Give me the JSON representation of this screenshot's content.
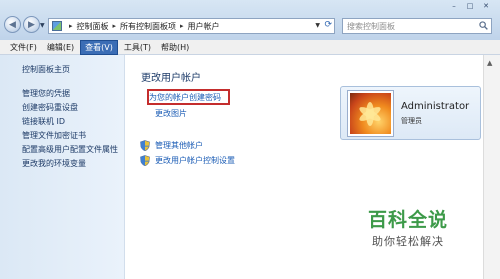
{
  "window": {
    "controls": [
      "–",
      "□",
      "✕"
    ]
  },
  "address_bar": {
    "breadcrumbs": [
      "控制面板",
      "所有控制面板项",
      "用户帐户"
    ],
    "separator": "▸"
  },
  "search": {
    "placeholder": "搜索控制面板"
  },
  "menubar": {
    "items": [
      "文件(F)",
      "编辑(E)",
      "查看(V)",
      "工具(T)",
      "帮助(H)"
    ],
    "active": "查看(V)"
  },
  "sidebar": {
    "home": "控制面板主页",
    "links": [
      "管理您的凭据",
      "创建密码重设盘",
      "链接联机 ID",
      "管理文件加密证书",
      "配置高级用户配置文件属性",
      "更改我的环境变量"
    ]
  },
  "main": {
    "title": "更改用户帐户",
    "create_password": "为您的帐户创建密码",
    "change_picture": "更改图片",
    "manage_other": "管理其他帐户",
    "uac_settings": "更改用户帐户控制设置"
  },
  "user": {
    "name": "Administrator",
    "role": "管理员"
  },
  "watermark": {
    "title": "百科全说",
    "subtitle": "助你轻松解决"
  },
  "colors": {
    "link": "#1b5cb5",
    "highlight_box": "#c42d2d",
    "menu_active": "#3b6db5",
    "watermark_green": "#3d9a49"
  }
}
